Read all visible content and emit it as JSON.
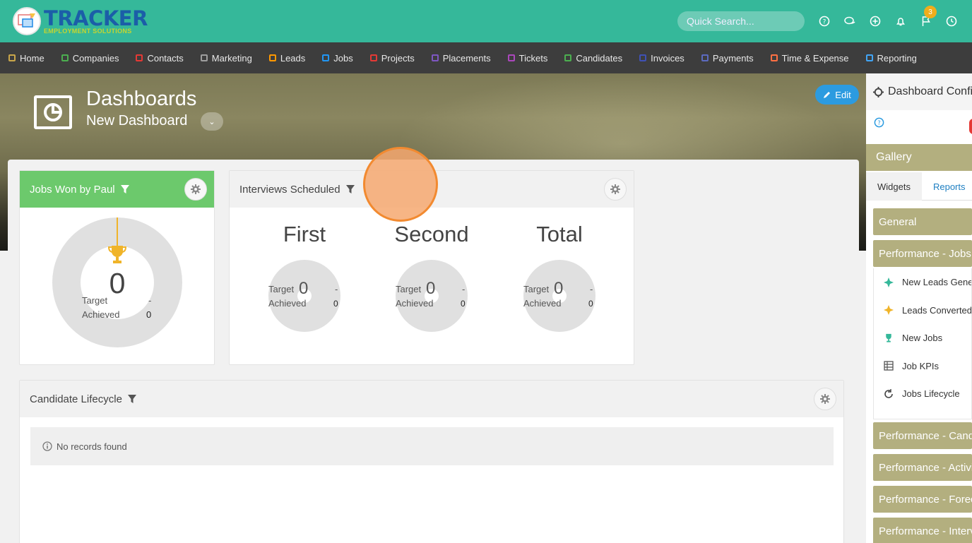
{
  "brand": {
    "name": "TRACKER",
    "tagline": "EMPLOYMENT SOLUTIONS"
  },
  "search": {
    "placeholder": "Quick Search..."
  },
  "top_icons": [
    "help-icon",
    "chat-icon",
    "add-icon",
    "bell-icon",
    "flag-icon",
    "history-icon"
  ],
  "flag_badge": "3",
  "nav": [
    {
      "label": "Home",
      "color": "#c9a64a"
    },
    {
      "label": "Companies",
      "color": "#4caf50"
    },
    {
      "label": "Contacts",
      "color": "#e53935"
    },
    {
      "label": "Marketing",
      "color": "#9e9e9e"
    },
    {
      "label": "Leads",
      "color": "#ff9800"
    },
    {
      "label": "Jobs",
      "color": "#2196f3"
    },
    {
      "label": "Projects",
      "color": "#e53935"
    },
    {
      "label": "Placements",
      "color": "#7e57c2"
    },
    {
      "label": "Tickets",
      "color": "#ab47bc"
    },
    {
      "label": "Candidates",
      "color": "#4caf50"
    },
    {
      "label": "Invoices",
      "color": "#3f51b5"
    },
    {
      "label": "Payments",
      "color": "#5c6bc0"
    },
    {
      "label": "Time & Expense",
      "color": "#ff7043"
    },
    {
      "label": "Reporting",
      "color": "#42a5f5"
    }
  ],
  "header": {
    "title": "Dashboards",
    "subtitle": "New Dashboard",
    "edit_label": "Edit"
  },
  "widgets": {
    "jobs_won": {
      "title": "Jobs Won by Paul",
      "value": "0",
      "target_label": "Target",
      "target_value": "-",
      "achieved_label": "Achieved",
      "achieved_value": "0",
      "color": "#6cc96c"
    },
    "interviews": {
      "title": "Interviews Scheduled",
      "columns": [
        {
          "title": "First",
          "value": "0",
          "target_label": "Target",
          "target_value": "-",
          "achieved_label": "Achieved",
          "achieved_value": "0"
        },
        {
          "title": "Second",
          "value": "0",
          "target_label": "Target",
          "target_value": "-",
          "achieved_label": "Achieved",
          "achieved_value": "0"
        },
        {
          "title": "Total",
          "value": "0",
          "target_label": "Target",
          "target_value": "-",
          "achieved_label": "Achieved",
          "achieved_value": "0"
        }
      ]
    },
    "lifecycle": {
      "title": "Candidate Lifecycle",
      "empty_message": "No records found"
    }
  },
  "side_panel": {
    "title": "Dashboard Configuration",
    "gallery_label": "Gallery",
    "tabs": [
      "Widgets",
      "Reports"
    ],
    "categories": [
      "General",
      "Performance - Jobs",
      "Performance - Candidates",
      "Performance - Activities",
      "Performance - Forecast",
      "Performance - Interviews"
    ],
    "job_items": [
      {
        "label": "New Leads Generated",
        "icon": "leads-icon"
      },
      {
        "label": "Leads Converted",
        "icon": "converted-icon"
      },
      {
        "label": "New Jobs",
        "icon": "trophy-icon"
      },
      {
        "label": "Job KPIs",
        "icon": "table-icon"
      },
      {
        "label": "Jobs Lifecycle",
        "icon": "cycle-icon"
      }
    ]
  }
}
